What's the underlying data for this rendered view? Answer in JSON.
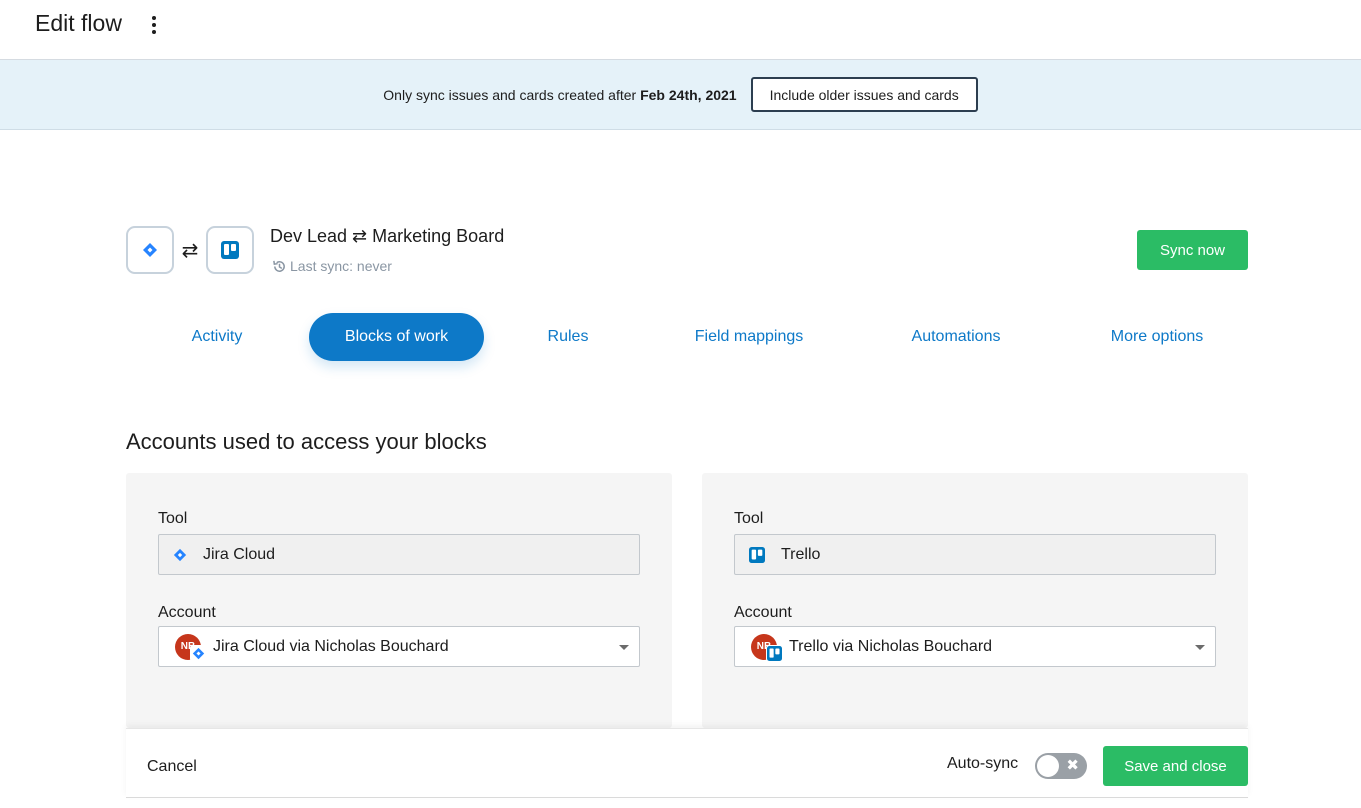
{
  "header": {
    "title": "Edit flow",
    "menu_icon": "kebab-menu-icon"
  },
  "banner": {
    "text_prefix": "Only sync issues and cards created after ",
    "date": "Feb 24th, 2021",
    "button_label": "Include older issues and cards"
  },
  "flow": {
    "left_tool_icon": "jira-icon",
    "right_tool_icon": "trello-icon",
    "swap_symbol": "⇄",
    "name": "Dev Lead ⇄ Marketing Board",
    "last_sync": "Last sync: never",
    "sync_button": "Sync now"
  },
  "tabs": [
    {
      "label": "Activity",
      "active": false
    },
    {
      "label": "Blocks of work",
      "active": true
    },
    {
      "label": "Rules",
      "active": false
    },
    {
      "label": "Field mappings",
      "active": false
    },
    {
      "label": "Automations",
      "active": false
    },
    {
      "label": "More options",
      "active": false
    }
  ],
  "section": {
    "title": "Accounts used to access your blocks"
  },
  "panels": {
    "left": {
      "tool_label": "Tool",
      "tool_value": "Jira Cloud",
      "account_label": "Account",
      "account_value": "Jira Cloud via Nicholas Bouchard",
      "avatar_initials": "NB"
    },
    "right": {
      "tool_label": "Tool",
      "tool_value": "Trello",
      "account_label": "Account",
      "account_value": "Trello via Nicholas Bouchard",
      "avatar_initials": "NB"
    }
  },
  "footer": {
    "cancel_label": "Cancel",
    "auto_sync_label": "Auto-sync",
    "auto_sync_on": false,
    "save_label": "Save and close"
  },
  "colors": {
    "accent_blue": "#0d79c8",
    "green": "#2bbc65",
    "banner_bg": "#e5f2f9",
    "jira_blue": "#2684ff",
    "trello_blue": "#0079bf",
    "avatar_red": "#c6361b"
  }
}
